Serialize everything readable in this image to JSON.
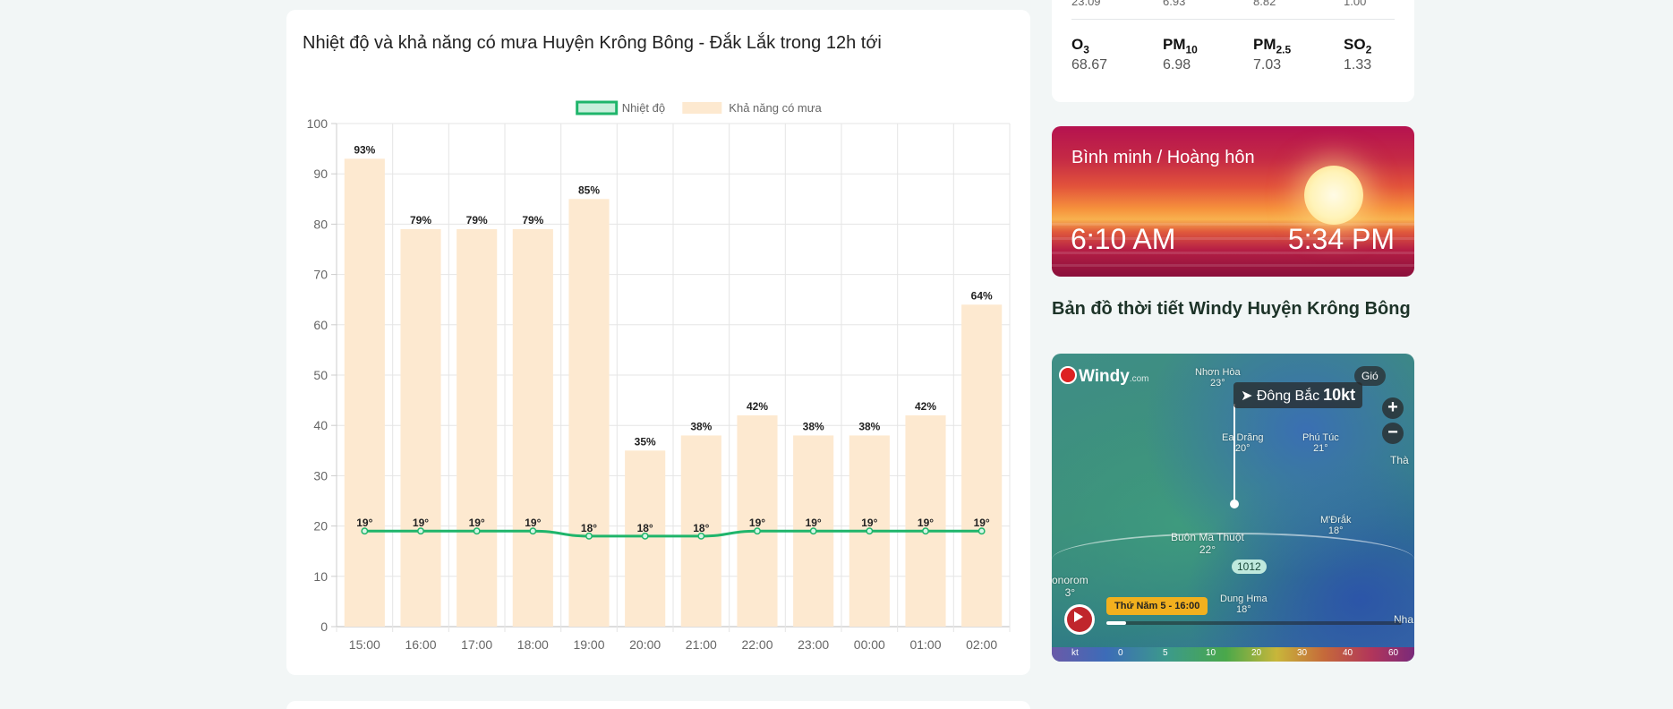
{
  "chart_card": {
    "title": "Nhiệt độ và khả năng có mưa Huyện Krông Bông - Đắk Lắk trong 12h tới"
  },
  "chart_data": {
    "type": "bar",
    "categories": [
      "15:00",
      "16:00",
      "17:00",
      "18:00",
      "19:00",
      "20:00",
      "21:00",
      "22:00",
      "23:00",
      "00:00",
      "01:00",
      "02:00"
    ],
    "series": [
      {
        "name": "Khả năng có mưa",
        "kind": "bar",
        "color": "#fde9d0",
        "values": [
          93,
          79,
          79,
          79,
          85,
          35,
          38,
          42,
          38,
          38,
          42,
          64
        ],
        "label_suffix": "%"
      },
      {
        "name": "Nhiệt độ",
        "kind": "line",
        "color": "#1fb56b",
        "values": [
          19,
          19,
          19,
          19,
          18,
          18,
          18,
          19,
          19,
          19,
          19,
          19
        ],
        "label_suffix": "°"
      }
    ],
    "ylim": [
      0,
      100
    ],
    "yticks": [
      0,
      10,
      20,
      30,
      40,
      50,
      60,
      70,
      80,
      90,
      100
    ],
    "grid": true,
    "legend_position": "top-center"
  },
  "air_quality": {
    "top_row": [
      "23.09",
      "6.93",
      "8.82",
      "1.00"
    ],
    "items": [
      {
        "name": "O",
        "sub": "3",
        "value": "68.67"
      },
      {
        "name": "PM",
        "sub": "10",
        "value": "6.98"
      },
      {
        "name": "PM",
        "sub": "2.5",
        "value": "7.03"
      },
      {
        "name": "SO",
        "sub": "2",
        "value": "1.33"
      }
    ]
  },
  "sun": {
    "title": "Bình minh / Hoàng hôn",
    "sunrise": "6:10 AM",
    "sunset": "5:34 PM"
  },
  "map": {
    "heading": "Bản đồ thời tiết Windy Huyện Krông Bông",
    "logo": "Windy",
    "logo_suffix": ".com",
    "layer_label": "Gió",
    "wind_direction": "Đông Bắc",
    "wind_speed": "10kt",
    "pressure": "1012",
    "time_label": "Thứ Năm 5 - 16:00",
    "cities": [
      {
        "name": "Nhơn Hòa",
        "temp": "23°"
      },
      {
        "name": "Ea Drăng",
        "temp": "20°"
      },
      {
        "name": "Phú Túc",
        "temp": "21°"
      },
      {
        "name": "Buôn Ma Thuột",
        "temp": "22°"
      },
      {
        "name": "M'Đrắk",
        "temp": "18°"
      },
      {
        "name": "Dung Hma",
        "temp": "18°"
      },
      {
        "name": "Thà",
        "temp": ""
      },
      {
        "name": "onorom",
        "temp": "3°"
      },
      {
        "name": "Nha",
        "temp": ""
      }
    ],
    "scale_labels": [
      "kt",
      "0",
      "5",
      "10",
      "20",
      "30",
      "40",
      "60"
    ]
  }
}
